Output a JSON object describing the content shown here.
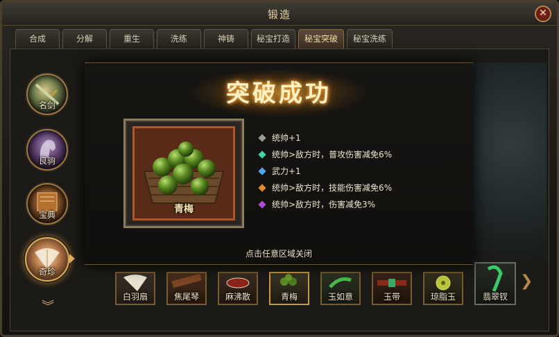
{
  "window": {
    "title": "锻造",
    "close_icon": "✕"
  },
  "tabs": [
    {
      "label": "合成",
      "active": false
    },
    {
      "label": "分解",
      "active": false
    },
    {
      "label": "重生",
      "active": false
    },
    {
      "label": "洗练",
      "active": false
    },
    {
      "label": "神铸",
      "active": false
    },
    {
      "label": "秘宝打造",
      "active": false
    },
    {
      "label": "秘宝突破",
      "active": true
    },
    {
      "label": "秘宝洗练",
      "active": false
    }
  ],
  "sidebar": {
    "items": [
      {
        "label": "名剑",
        "icon": "sword-icon"
      },
      {
        "label": "良驹",
        "icon": "horse-icon"
      },
      {
        "label": "宝典",
        "icon": "book-icon"
      },
      {
        "label": "奇珍",
        "icon": "fan-icon",
        "selected": true
      }
    ],
    "scroll_icon": "chevron-down-icon"
  },
  "items": [
    {
      "label": "白羽扇",
      "icon": "feather-fan-icon"
    },
    {
      "label": "焦尾琴",
      "icon": "zither-icon"
    },
    {
      "label": "麻沸散",
      "icon": "herb-bowl-icon"
    },
    {
      "label": "青梅",
      "icon": "green-plum-icon",
      "active": true
    },
    {
      "label": "玉如意",
      "icon": "jade-ruyi-icon"
    },
    {
      "label": "玉带",
      "icon": "jade-belt-icon"
    },
    {
      "label": "琼脂玉",
      "icon": "jade-disc-icon"
    },
    {
      "label": "翡翠钗",
      "icon": "jade-hairpin-icon"
    }
  ],
  "popup": {
    "banner": "突破成功",
    "item_name": "青梅",
    "attributes": [
      {
        "text": "统帅+1",
        "gem_color": "#9a9a9a"
      },
      {
        "text": "统帅>敌方时，普攻伤害减免6%",
        "gem_color": "#3fd6a2"
      },
      {
        "text": "武力+1",
        "gem_color": "#4aa8e8"
      },
      {
        "text": "统帅>敌方时，技能伤害减免6%",
        "gem_color": "#e08a2a"
      },
      {
        "text": "统帅>敌方时，伤害减免3%",
        "gem_color": "#b04ad8"
      }
    ],
    "close_hint": "点击任意区域关闭"
  }
}
